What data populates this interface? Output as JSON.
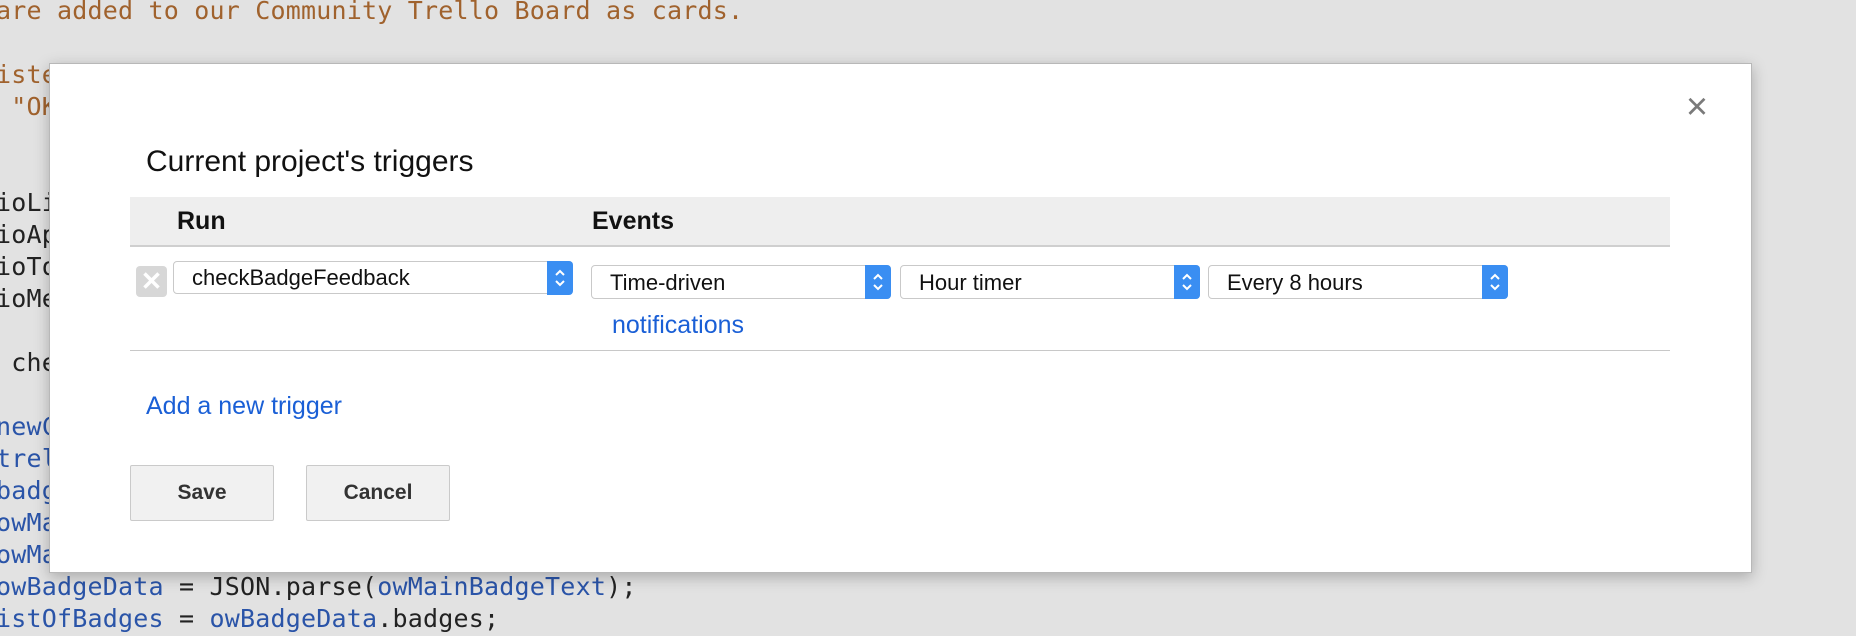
{
  "background_code": {
    "lines": [
      [
        {
          "t": "are added to our Community Trello Board as cards.",
          "c": "c-brown"
        }
      ],
      [
        {
          "t": "iste",
          "c": "c-brown"
        }
      ],
      [
        {
          "t": " \"OK",
          "c": "c-brown"
        }
      ],
      [
        {
          "t": "ioLi",
          "c": "c-dark"
        }
      ],
      [
        {
          "t": "ioAp",
          "c": "c-dark"
        }
      ],
      [
        {
          "t": "ioTo",
          "c": "c-dark"
        }
      ],
      [
        {
          "t": "ioMe",
          "c": "c-dark"
        }
      ],
      [
        {
          "t": " che",
          "c": "c-dark"
        }
      ],
      [
        {
          "t": "newC",
          "c": "c-blue"
        }
      ],
      [
        {
          "t": "trel",
          "c": "c-blue"
        }
      ],
      [
        {
          "t": "badg",
          "c": "c-blue"
        }
      ],
      [
        {
          "t": "owMa",
          "c": "c-blue"
        }
      ],
      [
        {
          "t": "owMa",
          "c": "c-blue"
        }
      ],
      [
        {
          "t": "owBadgeData",
          "c": "c-blue"
        },
        {
          "t": " = JSON.parse(",
          "c": "c-dark"
        },
        {
          "t": "owMainBadgeText",
          "c": "c-blue"
        },
        {
          "t": ");",
          "c": "c-dark"
        }
      ],
      [
        {
          "t": "istOfBadges",
          "c": "c-blue"
        },
        {
          "t": " = ",
          "c": "c-dark"
        },
        {
          "t": "owBadgeData",
          "c": "c-blue"
        },
        {
          "t": ".badges;",
          "c": "c-dark"
        }
      ]
    ]
  },
  "dialog": {
    "title": "Current project's triggers",
    "close_glyph": "×",
    "columns": {
      "run": "Run",
      "events": "Events"
    },
    "trigger": {
      "function": "checkBadgeFeedback",
      "event_source": "Time-driven",
      "timer_type": "Hour timer",
      "interval": "Every 8 hours",
      "notifications_link": "notifications"
    },
    "add_trigger_link": "Add a new trigger",
    "save_label": "Save",
    "cancel_label": "Cancel"
  },
  "colors": {
    "link": "#1a5fd6",
    "select_arrow": "#3a8ef2"
  }
}
